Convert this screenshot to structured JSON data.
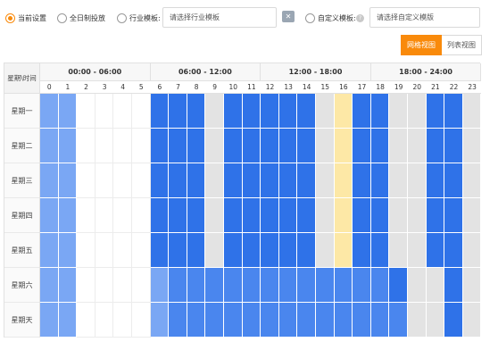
{
  "toolbar": {
    "radio_options": [
      {
        "label": "当前设置",
        "checked": true
      },
      {
        "label": "全日制投放",
        "checked": false
      },
      {
        "label": "行业模板:",
        "checked": false
      },
      {
        "label": "自定义模板:",
        "checked": false
      }
    ],
    "industry_template_placeholder": "请选择行业模板",
    "custom_template_placeholder": "请选择自定义模版",
    "clear_icon": "clear-template-icon",
    "help_icon": "question-circle-icon"
  },
  "view_switch": {
    "grid_view_label": "网格视图",
    "list_view_label": "列表视图",
    "active": "grid"
  },
  "schedule": {
    "corner_label": "星期\\时间",
    "ranges": [
      "00:00 - 06:00",
      "06:00 - 12:00",
      "12:00 - 18:00",
      "18:00 - 24:00"
    ],
    "hours": [
      "0",
      "1",
      "2",
      "3",
      "4",
      "5",
      "6",
      "7",
      "8",
      "9",
      "10",
      "11",
      "12",
      "13",
      "14",
      "15",
      "16",
      "17",
      "18",
      "19",
      "20",
      "21",
      "22",
      "23"
    ],
    "days": [
      "星期一",
      "星期二",
      "星期三",
      "星期四",
      "星期五",
      "星期六",
      "星期天"
    ],
    "legend_colors": {
      "light": "#7aa7f4",
      "dark": "#2f72e8",
      "medium": "#4a86ee",
      "gray": "#e3e3e3",
      "yellow": "#fde8a6",
      "empty": "#ffffff"
    },
    "cells": [
      "LL....ddd.ddddd.ydd..dd",
      "LL....ddd.ddddd.ydd..dd",
      "LL....ddd.ddddd.ydd..dd",
      "LL....ddd.ddddd.ydd..dd",
      "LL....ddd.ddddd.ydd..dd",
      "LL....lmmmmmmmmmmmmd..d",
      "LL....lmmmmmmmmmmmmm..d"
    ]
  }
}
